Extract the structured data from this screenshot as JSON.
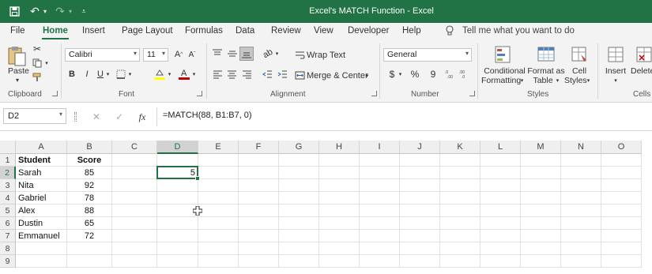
{
  "title": "Excel's MATCH Function  -  Excel",
  "tabs": [
    "File",
    "Home",
    "Insert",
    "Page Layout",
    "Formulas",
    "Data",
    "Review",
    "View",
    "Developer",
    "Help"
  ],
  "active_tab": "Home",
  "tell_me": "Tell me what you want to do",
  "ribbon": {
    "clipboard": {
      "paste": "Paste",
      "group": "Clipboard"
    },
    "font": {
      "name": "Calibri",
      "size": "11",
      "bold": "B",
      "italic": "I",
      "underline": "U",
      "group": "Font"
    },
    "alignment": {
      "wrap": "Wrap Text",
      "merge": "Merge & Center",
      "group": "Alignment"
    },
    "number": {
      "format": "General",
      "currency": "$",
      "percent": "%",
      "comma": "9",
      "group": "Number"
    },
    "styles": {
      "conditional_1": "Conditional",
      "conditional_2": "Formatting",
      "format_table_1": "Format as",
      "format_table_2": "Table",
      "cell_styles_1": "Cell",
      "cell_styles_2": "Styles",
      "group": "Styles"
    },
    "cells": {
      "insert": "Insert",
      "delete": "Delete",
      "group": "Cells"
    }
  },
  "formula_bar": {
    "name_box": "D2",
    "cancel": "✕",
    "enter": "✓",
    "fx": "fx",
    "formula": "=MATCH(88, B1:B7, 0)"
  },
  "columns": [
    "A",
    "B",
    "C",
    "D",
    "E",
    "F",
    "G",
    "H",
    "I",
    "J",
    "K",
    "L",
    "M",
    "N",
    "O"
  ],
  "rows": [
    "1",
    "2",
    "3",
    "4",
    "5",
    "6",
    "7",
    "8",
    "9"
  ],
  "cells": {
    "A1": "Student",
    "B1": "Score",
    "A2": "Sarah",
    "B2": "85",
    "A3": "Nita",
    "B3": "92",
    "A4": "Gabriel",
    "B4": "78",
    "A5": "Alex",
    "B5": "88",
    "A6": "Dustin",
    "B6": "65",
    "A7": "Emmanuel",
    "B7": "72",
    "D2": "5"
  },
  "colors": {
    "accent": "#217346",
    "font_color": "#c00000",
    "highlight": "#ffff00"
  }
}
